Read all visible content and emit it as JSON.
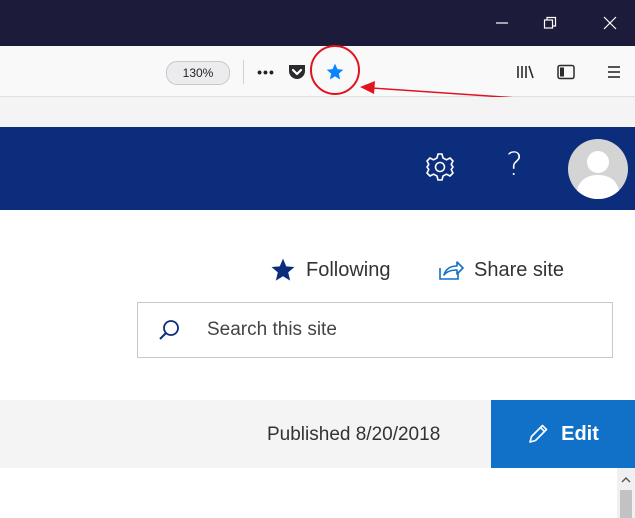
{
  "browser": {
    "zoom_label": "130%",
    "overflow_label": "•••",
    "icons": [
      "pocket-icon",
      "bookmark-star-icon",
      "library-icon",
      "sidebar-icon",
      "hamburger-menu-icon"
    ],
    "window_controls": [
      "minimize-icon",
      "restore-icon",
      "close-icon"
    ]
  },
  "suite_bar": {
    "background": "#0c2d7c",
    "help_label": "?",
    "icons": [
      "settings-gear-icon",
      "help-icon",
      "user-avatar"
    ]
  },
  "site_header": {
    "following_label": "Following",
    "share_label": "Share site",
    "search_placeholder": "Search this site"
  },
  "command_bar": {
    "published_label": "Published 8/20/2018",
    "edit_label": "Edit",
    "edit_color": "#1170c8"
  },
  "annotation": {
    "color": "#e0141e"
  }
}
